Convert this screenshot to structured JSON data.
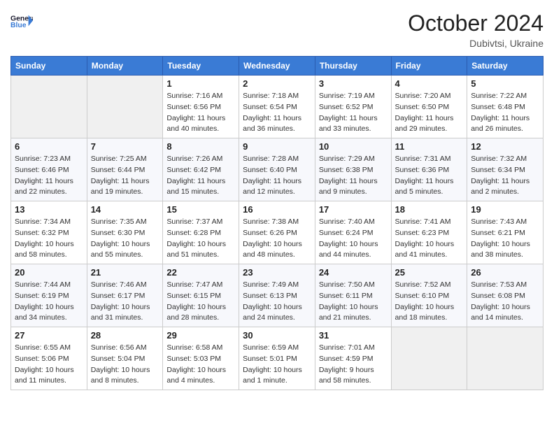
{
  "header": {
    "logo_line1": "General",
    "logo_line2": "Blue",
    "month": "October 2024",
    "location": "Dubivtsi, Ukraine"
  },
  "weekdays": [
    "Sunday",
    "Monday",
    "Tuesday",
    "Wednesday",
    "Thursday",
    "Friday",
    "Saturday"
  ],
  "weeks": [
    [
      {
        "day": "",
        "info": ""
      },
      {
        "day": "",
        "info": ""
      },
      {
        "day": "1",
        "info": "Sunrise: 7:16 AM\nSunset: 6:56 PM\nDaylight: 11 hours and 40 minutes."
      },
      {
        "day": "2",
        "info": "Sunrise: 7:18 AM\nSunset: 6:54 PM\nDaylight: 11 hours and 36 minutes."
      },
      {
        "day": "3",
        "info": "Sunrise: 7:19 AM\nSunset: 6:52 PM\nDaylight: 11 hours and 33 minutes."
      },
      {
        "day": "4",
        "info": "Sunrise: 7:20 AM\nSunset: 6:50 PM\nDaylight: 11 hours and 29 minutes."
      },
      {
        "day": "5",
        "info": "Sunrise: 7:22 AM\nSunset: 6:48 PM\nDaylight: 11 hours and 26 minutes."
      }
    ],
    [
      {
        "day": "6",
        "info": "Sunrise: 7:23 AM\nSunset: 6:46 PM\nDaylight: 11 hours and 22 minutes."
      },
      {
        "day": "7",
        "info": "Sunrise: 7:25 AM\nSunset: 6:44 PM\nDaylight: 11 hours and 19 minutes."
      },
      {
        "day": "8",
        "info": "Sunrise: 7:26 AM\nSunset: 6:42 PM\nDaylight: 11 hours and 15 minutes."
      },
      {
        "day": "9",
        "info": "Sunrise: 7:28 AM\nSunset: 6:40 PM\nDaylight: 11 hours and 12 minutes."
      },
      {
        "day": "10",
        "info": "Sunrise: 7:29 AM\nSunset: 6:38 PM\nDaylight: 11 hours and 9 minutes."
      },
      {
        "day": "11",
        "info": "Sunrise: 7:31 AM\nSunset: 6:36 PM\nDaylight: 11 hours and 5 minutes."
      },
      {
        "day": "12",
        "info": "Sunrise: 7:32 AM\nSunset: 6:34 PM\nDaylight: 11 hours and 2 minutes."
      }
    ],
    [
      {
        "day": "13",
        "info": "Sunrise: 7:34 AM\nSunset: 6:32 PM\nDaylight: 10 hours and 58 minutes."
      },
      {
        "day": "14",
        "info": "Sunrise: 7:35 AM\nSunset: 6:30 PM\nDaylight: 10 hours and 55 minutes."
      },
      {
        "day": "15",
        "info": "Sunrise: 7:37 AM\nSunset: 6:28 PM\nDaylight: 10 hours and 51 minutes."
      },
      {
        "day": "16",
        "info": "Sunrise: 7:38 AM\nSunset: 6:26 PM\nDaylight: 10 hours and 48 minutes."
      },
      {
        "day": "17",
        "info": "Sunrise: 7:40 AM\nSunset: 6:24 PM\nDaylight: 10 hours and 44 minutes."
      },
      {
        "day": "18",
        "info": "Sunrise: 7:41 AM\nSunset: 6:23 PM\nDaylight: 10 hours and 41 minutes."
      },
      {
        "day": "19",
        "info": "Sunrise: 7:43 AM\nSunset: 6:21 PM\nDaylight: 10 hours and 38 minutes."
      }
    ],
    [
      {
        "day": "20",
        "info": "Sunrise: 7:44 AM\nSunset: 6:19 PM\nDaylight: 10 hours and 34 minutes."
      },
      {
        "day": "21",
        "info": "Sunrise: 7:46 AM\nSunset: 6:17 PM\nDaylight: 10 hours and 31 minutes."
      },
      {
        "day": "22",
        "info": "Sunrise: 7:47 AM\nSunset: 6:15 PM\nDaylight: 10 hours and 28 minutes."
      },
      {
        "day": "23",
        "info": "Sunrise: 7:49 AM\nSunset: 6:13 PM\nDaylight: 10 hours and 24 minutes."
      },
      {
        "day": "24",
        "info": "Sunrise: 7:50 AM\nSunset: 6:11 PM\nDaylight: 10 hours and 21 minutes."
      },
      {
        "day": "25",
        "info": "Sunrise: 7:52 AM\nSunset: 6:10 PM\nDaylight: 10 hours and 18 minutes."
      },
      {
        "day": "26",
        "info": "Sunrise: 7:53 AM\nSunset: 6:08 PM\nDaylight: 10 hours and 14 minutes."
      }
    ],
    [
      {
        "day": "27",
        "info": "Sunrise: 6:55 AM\nSunset: 5:06 PM\nDaylight: 10 hours and 11 minutes."
      },
      {
        "day": "28",
        "info": "Sunrise: 6:56 AM\nSunset: 5:04 PM\nDaylight: 10 hours and 8 minutes."
      },
      {
        "day": "29",
        "info": "Sunrise: 6:58 AM\nSunset: 5:03 PM\nDaylight: 10 hours and 4 minutes."
      },
      {
        "day": "30",
        "info": "Sunrise: 6:59 AM\nSunset: 5:01 PM\nDaylight: 10 hours and 1 minute."
      },
      {
        "day": "31",
        "info": "Sunrise: 7:01 AM\nSunset: 4:59 PM\nDaylight: 9 hours and 58 minutes."
      },
      {
        "day": "",
        "info": ""
      },
      {
        "day": "",
        "info": ""
      }
    ]
  ]
}
